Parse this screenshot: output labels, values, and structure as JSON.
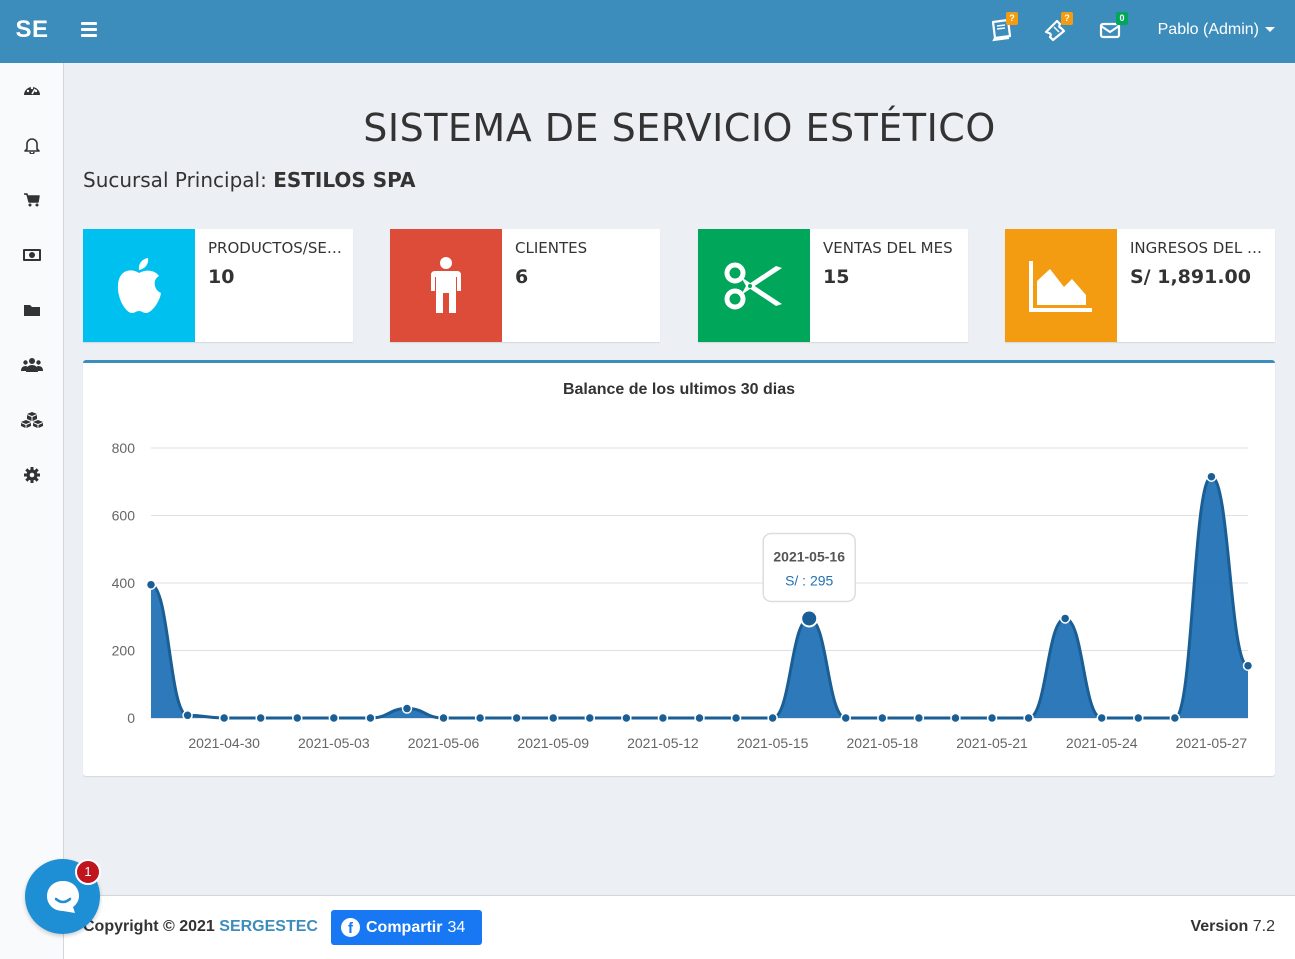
{
  "header": {
    "brand": "SE",
    "notifications": [
      {
        "icon": "book-icon",
        "badge": "?",
        "badge_color": "#f39c12"
      },
      {
        "icon": "ticket-icon",
        "badge": "?",
        "badge_color": "#f39c12"
      },
      {
        "icon": "envelope-icon",
        "badge": "0",
        "badge_color": "#00a65a"
      }
    ],
    "user": "Pablo (Admin)"
  },
  "sidebar": {
    "items": [
      {
        "icon": "dashboard-icon"
      },
      {
        "icon": "bell-icon"
      },
      {
        "icon": "cart-icon"
      },
      {
        "icon": "money-icon"
      },
      {
        "icon": "folder-icon"
      },
      {
        "icon": "users-icon"
      },
      {
        "icon": "cubes-icon"
      },
      {
        "icon": "gear-icon"
      }
    ]
  },
  "main": {
    "title": "SISTEMA DE SERVICIO ESTÉTICO",
    "branch_label": "Sucursal Principal:",
    "branch_name": "ESTILOS SPA",
    "info_boxes": [
      {
        "label": "PRODUCTOS/SERVICIOS",
        "value": "10",
        "color": "#00c0ef",
        "icon": "apple-icon"
      },
      {
        "label": "CLIENTES",
        "value": "6",
        "color": "#dd4b39",
        "icon": "person-icon"
      },
      {
        "label": "VENTAS DEL MES",
        "value": "15",
        "color": "#00a65a",
        "icon": "scissors-icon"
      },
      {
        "label": "INGRESOS DEL MES",
        "value": "S/ 1,891.00",
        "color": "#f39c12",
        "icon": "area-chart-icon"
      }
    ]
  },
  "chart_data": {
    "type": "area",
    "title": "Balance de los ultimos 30 dias",
    "ylim": [
      0,
      800
    ],
    "yticks": [
      0,
      200,
      400,
      600,
      800
    ],
    "x": [
      "2021-04-28",
      "2021-04-29",
      "2021-04-30",
      "2021-05-01",
      "2021-05-02",
      "2021-05-03",
      "2021-05-04",
      "2021-05-05",
      "2021-05-06",
      "2021-05-07",
      "2021-05-08",
      "2021-05-09",
      "2021-05-10",
      "2021-05-11",
      "2021-05-12",
      "2021-05-13",
      "2021-05-14",
      "2021-05-15",
      "2021-05-16",
      "2021-05-17",
      "2021-05-18",
      "2021-05-19",
      "2021-05-20",
      "2021-05-21",
      "2021-05-22",
      "2021-05-23",
      "2021-05-24",
      "2021-05-25",
      "2021-05-26",
      "2021-05-27",
      "2021-05-28"
    ],
    "xticks": [
      "2021-04-30",
      "2021-05-03",
      "2021-05-06",
      "2021-05-09",
      "2021-05-12",
      "2021-05-15",
      "2021-05-18",
      "2021-05-21",
      "2021-05-24",
      "2021-05-27"
    ],
    "series": [
      {
        "values": [
          395,
          8,
          0,
          0,
          0,
          0,
          0,
          28,
          0,
          0,
          0,
          0,
          0,
          0,
          0,
          0,
          0,
          0,
          295,
          0,
          0,
          0,
          0,
          0,
          0,
          295,
          0,
          0,
          0,
          715,
          155
        ],
        "color": "#2272b5"
      }
    ],
    "tooltip": {
      "date": "2021-05-16",
      "label": "S/ : 295",
      "index": 18
    },
    "grid": true,
    "legend": "none"
  },
  "footer": {
    "copyright_prefix": "Copyright © 2021",
    "company": "SERGESTEC",
    "share_label": "Compartir",
    "share_count": "34",
    "version_label": "Version",
    "version_value": "7.2"
  },
  "chat": {
    "badge": "1"
  }
}
